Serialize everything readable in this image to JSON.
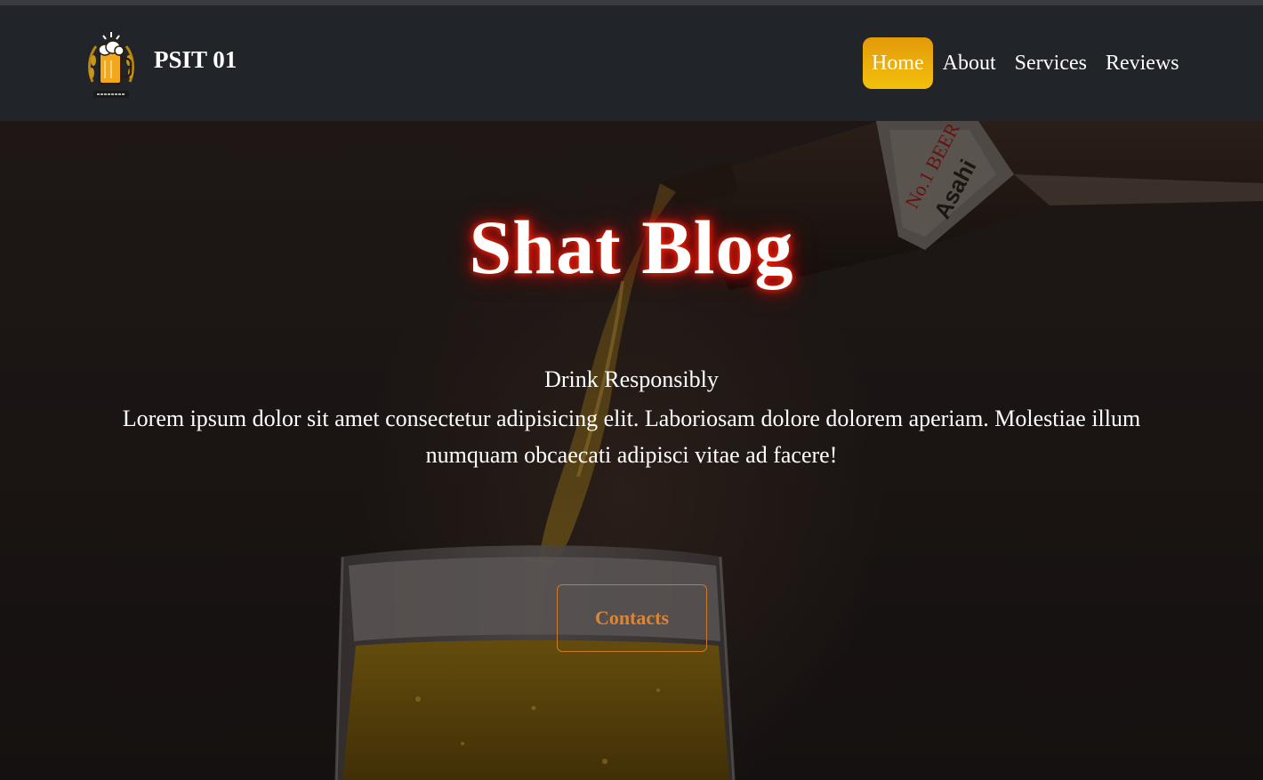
{
  "header": {
    "brand": "PSIT 01",
    "logo_icon": "beer-mug-logo-icon",
    "nav": [
      {
        "label": "Home",
        "active": true
      },
      {
        "label": "About",
        "active": false
      },
      {
        "label": "Services",
        "active": false
      },
      {
        "label": "Reviews",
        "active": false
      }
    ]
  },
  "hero": {
    "title": "Shat Blog",
    "tagline": "Drink Responsibly",
    "description": "Lorem ipsum dolor sit amet consectetur adipisicing elit. Laboriosam dolore dolorem aperiam. Molestiae illum numquam obcaecati adipisci vitae ad facere!",
    "contact_button": "Contacts",
    "background_image": "beer-pouring-photo"
  },
  "colors": {
    "navbar_bg": "#212529",
    "active_nav_bg": "#f0b40c",
    "title_glow": "#e01a1a",
    "button_text": "#d8873a"
  }
}
